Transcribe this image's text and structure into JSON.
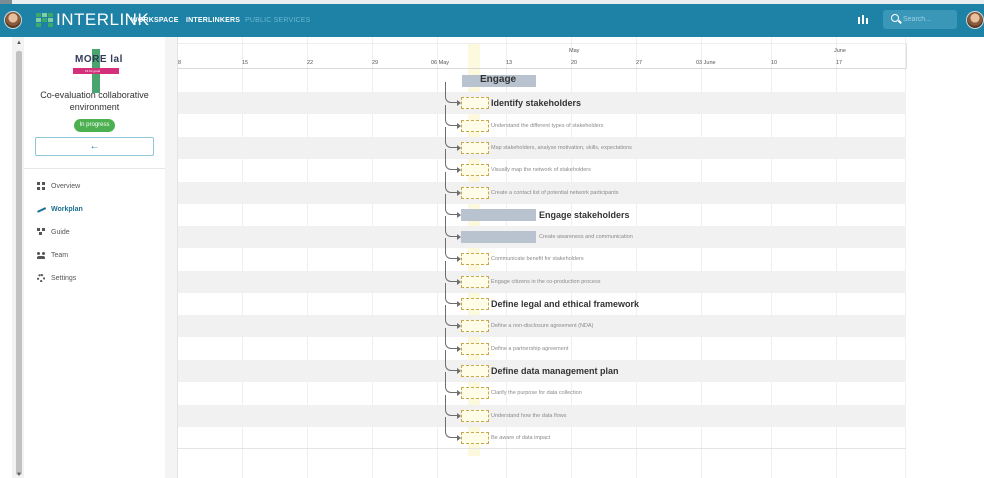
{
  "app": {
    "logo_text": "INTERLINK",
    "nav": [
      "WORKSPACE",
      "INTERLINKERS",
      "PUBLIC SERVICES"
    ],
    "search_placeholder": "Search..."
  },
  "sidebar": {
    "project_logo_text": "MORE lal",
    "project_logo_sub": "Fit for good",
    "project_title": "Co-evaluation collaborative environment",
    "status": "In progress",
    "back_symbol": "←",
    "menu": [
      {
        "label": "Overview",
        "icon": "overview-icon"
      },
      {
        "label": "Workplan",
        "icon": "trend-icon",
        "active": true
      },
      {
        "label": "Guide",
        "icon": "guide-icon"
      },
      {
        "label": "Team",
        "icon": "team-icon"
      },
      {
        "label": "Settings",
        "icon": "settings-icon"
      }
    ]
  },
  "gantt": {
    "months": [
      "May",
      "June"
    ],
    "ticks": [
      "8",
      "15",
      "22",
      "29",
      "06 May",
      "13",
      "20",
      "27",
      "03 June",
      "10",
      "17"
    ],
    "tasks": [
      {
        "label": "Engage",
        "level": "phase"
      },
      {
        "label": "Identify stakeholders",
        "level": "group"
      },
      {
        "label": "Understand the different types of stakeholders",
        "level": "task"
      },
      {
        "label": "Map stakeholders, analyse motivation, skills, expectations",
        "level": "task"
      },
      {
        "label": "Visually map the network of stakeholders",
        "level": "task"
      },
      {
        "label": "Create a contact list of potential network participants",
        "level": "task"
      },
      {
        "label": "Engage stakeholders",
        "level": "group"
      },
      {
        "label": "Create awareness and communication",
        "level": "task"
      },
      {
        "label": "Communicate benefit for stakeholders",
        "level": "task"
      },
      {
        "label": "Engage citizens in the co-production process",
        "level": "task"
      },
      {
        "label": "Define legal and ethical framework",
        "level": "group"
      },
      {
        "label": "Define a non-disclosure agreement (NDA)",
        "level": "task"
      },
      {
        "label": "Define a partnership agreement",
        "level": "task"
      },
      {
        "label": "Define data management plan",
        "level": "group"
      },
      {
        "label": "Clarify the purpose for data collection",
        "level": "task"
      },
      {
        "label": "Understand how the data flows",
        "level": "task"
      },
      {
        "label": "Be aware of data impact",
        "level": "task"
      }
    ]
  }
}
